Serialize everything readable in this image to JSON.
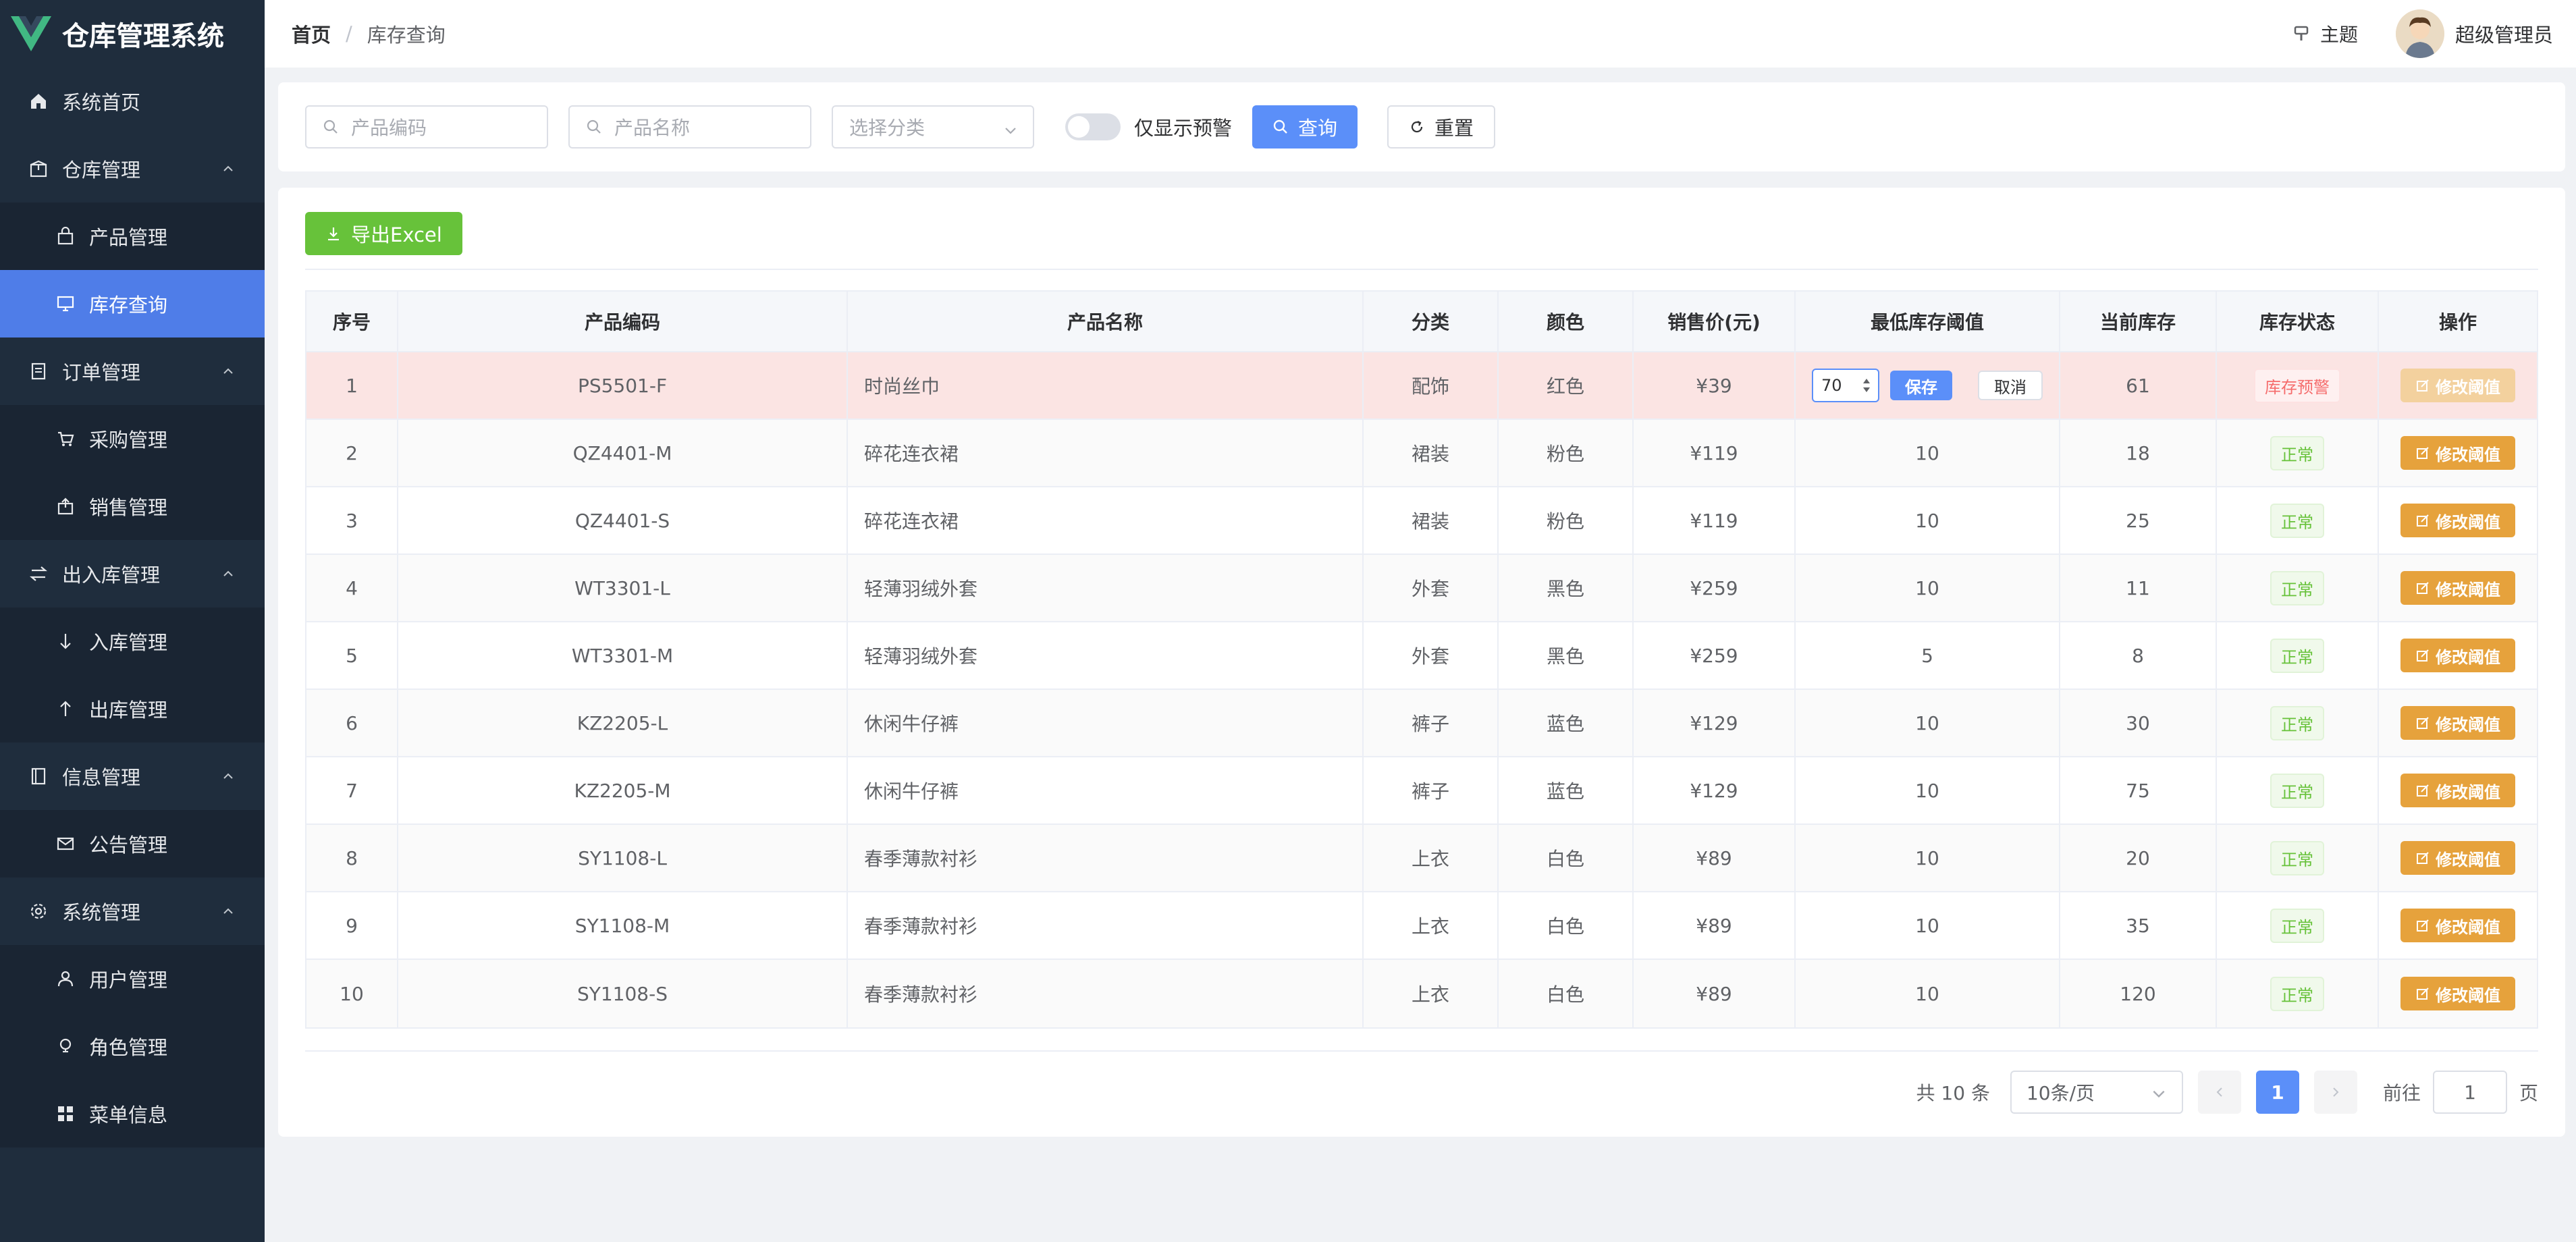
{
  "app": {
    "title": "仓库管理系统"
  },
  "sidebar": {
    "items": [
      {
        "label": "系统首页",
        "icon": "home-icon",
        "type": "item"
      },
      {
        "label": "仓库管理",
        "icon": "warehouse-icon",
        "type": "group"
      },
      {
        "label": "产品管理",
        "icon": "bag-icon",
        "type": "sub"
      },
      {
        "label": "库存查询",
        "icon": "monitor-icon",
        "type": "sub",
        "active": true
      },
      {
        "label": "订单管理",
        "icon": "document-icon",
        "type": "group"
      },
      {
        "label": "采购管理",
        "icon": "cart-icon",
        "type": "sub"
      },
      {
        "label": "销售管理",
        "icon": "sell-icon",
        "type": "sub"
      },
      {
        "label": "出入库管理",
        "icon": "switch-icon",
        "type": "group"
      },
      {
        "label": "入库管理",
        "icon": "arrow-down-icon",
        "type": "sub"
      },
      {
        "label": "出库管理",
        "icon": "arrow-up-icon",
        "type": "sub"
      },
      {
        "label": "信息管理",
        "icon": "notebook-icon",
        "type": "group"
      },
      {
        "label": "公告管理",
        "icon": "mail-icon",
        "type": "sub"
      },
      {
        "label": "系统管理",
        "icon": "gear-icon",
        "type": "group"
      },
      {
        "label": "用户管理",
        "icon": "user-icon",
        "type": "sub"
      },
      {
        "label": "角色管理",
        "icon": "bulb-icon",
        "type": "sub"
      },
      {
        "label": "菜单信息",
        "icon": "grid-icon",
        "type": "sub"
      }
    ]
  },
  "header": {
    "breadcrumb": {
      "home": "首页",
      "separator": "/",
      "current": "库存查询"
    },
    "theme_label": "主题",
    "user_name": "超级管理员"
  },
  "search": {
    "code_placeholder": "产品编码",
    "name_placeholder": "产品名称",
    "category_placeholder": "选择分类",
    "toggle_label": "仅显示预警",
    "query_label": "查询",
    "reset_label": "重置"
  },
  "toolbar": {
    "export_label": "导出Excel"
  },
  "table": {
    "headers": [
      "序号",
      "产品编码",
      "产品名称",
      "分类",
      "颜色",
      "销售价(元)",
      "最低库存阈值",
      "当前库存",
      "库存状态",
      "操作"
    ],
    "edit_label": "修改阈值",
    "save_label": "保存",
    "cancel_label": "取消",
    "rows": [
      {
        "no": "1",
        "code": "PS5501-F",
        "name": "时尚丝巾",
        "category": "配饰",
        "color": "红色",
        "price": "¥39",
        "threshold": "70",
        "stock": "61",
        "status": "库存预警",
        "editing": true
      },
      {
        "no": "2",
        "code": "QZ4401-M",
        "name": "碎花连衣裙",
        "category": "裙装",
        "color": "粉色",
        "price": "¥119",
        "threshold": "10",
        "stock": "18",
        "status": "正常"
      },
      {
        "no": "3",
        "code": "QZ4401-S",
        "name": "碎花连衣裙",
        "category": "裙装",
        "color": "粉色",
        "price": "¥119",
        "threshold": "10",
        "stock": "25",
        "status": "正常"
      },
      {
        "no": "4",
        "code": "WT3301-L",
        "name": "轻薄羽绒外套",
        "category": "外套",
        "color": "黑色",
        "price": "¥259",
        "threshold": "10",
        "stock": "11",
        "status": "正常"
      },
      {
        "no": "5",
        "code": "WT3301-M",
        "name": "轻薄羽绒外套",
        "category": "外套",
        "color": "黑色",
        "price": "¥259",
        "threshold": "5",
        "stock": "8",
        "status": "正常"
      },
      {
        "no": "6",
        "code": "KZ2205-L",
        "name": "休闲牛仔裤",
        "category": "裤子",
        "color": "蓝色",
        "price": "¥129",
        "threshold": "10",
        "stock": "30",
        "status": "正常"
      },
      {
        "no": "7",
        "code": "KZ2205-M",
        "name": "休闲牛仔裤",
        "category": "裤子",
        "color": "蓝色",
        "price": "¥129",
        "threshold": "10",
        "stock": "75",
        "status": "正常"
      },
      {
        "no": "8",
        "code": "SY1108-L",
        "name": "春季薄款衬衫",
        "category": "上衣",
        "color": "白色",
        "price": "¥89",
        "threshold": "10",
        "stock": "20",
        "status": "正常"
      },
      {
        "no": "9",
        "code": "SY1108-M",
        "name": "春季薄款衬衫",
        "category": "上衣",
        "color": "白色",
        "price": "¥89",
        "threshold": "10",
        "stock": "35",
        "status": "正常"
      },
      {
        "no": "10",
        "code": "SY1108-S",
        "name": "春季薄款衬衫",
        "category": "上衣",
        "color": "白色",
        "price": "¥89",
        "threshold": "10",
        "stock": "120",
        "status": "正常"
      }
    ]
  },
  "pagination": {
    "total_label": "共 10 条",
    "page_size": "10条/页",
    "current_page": "1",
    "goto_prefix": "前往",
    "goto_value": "1",
    "goto_suffix": "页"
  },
  "colors": {
    "sidebar_bg": "#1f2d3d",
    "active": "#4f7de8",
    "primary": "#5b8ff9",
    "success": "#67c23a",
    "warning": "#e6a23c",
    "danger": "#f56c6c",
    "warn_row": "#fbe4e3"
  }
}
